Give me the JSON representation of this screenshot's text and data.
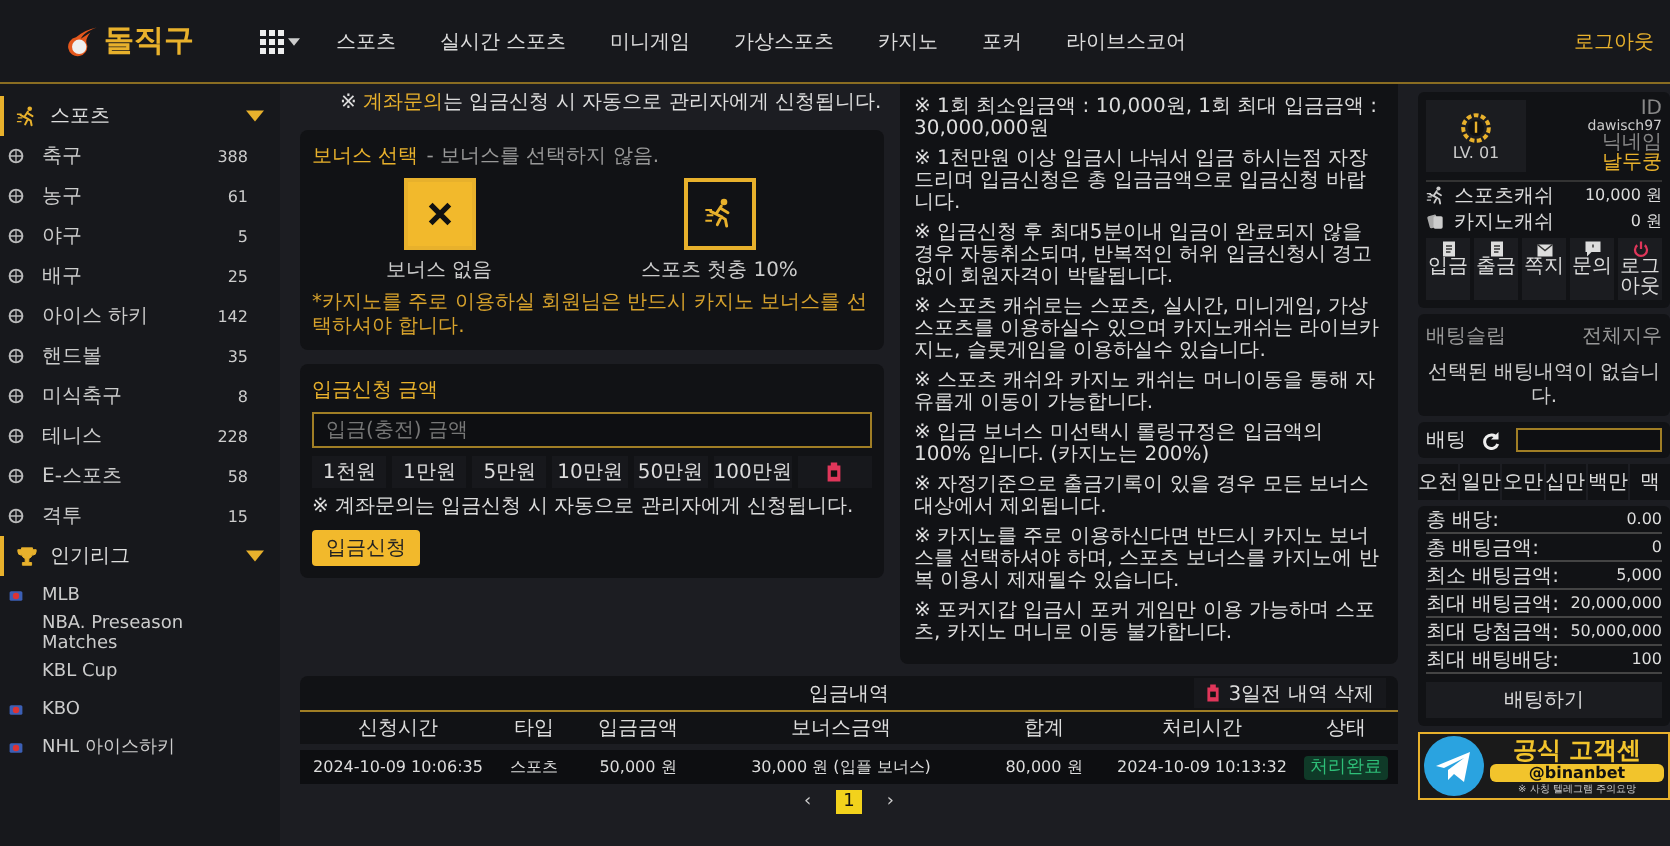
{
  "header": {
    "logo": "돌직구",
    "nav": [
      "스포츠",
      "실시간 스포츠",
      "미니게임",
      "가상스포츠",
      "카지노",
      "포커",
      "라이브스코어"
    ],
    "logout": "로그아웃"
  },
  "sidebar": {
    "sections": [
      {
        "title": "스포츠",
        "kind": "sports",
        "expanded": true,
        "items": [
          {
            "name": "축구",
            "count": "388"
          },
          {
            "name": "농구",
            "count": "61"
          },
          {
            "name": "야구",
            "count": "5"
          },
          {
            "name": "배구",
            "count": "25"
          },
          {
            "name": "아이스 하키",
            "count": "142"
          },
          {
            "name": "핸드볼",
            "count": "35"
          },
          {
            "name": "미식축구",
            "count": "8"
          },
          {
            "name": "테니스",
            "count": "228"
          },
          {
            "name": "E-스포츠",
            "count": "58"
          },
          {
            "name": "격투",
            "count": "15"
          }
        ]
      },
      {
        "title": "인기리그",
        "kind": "trophy",
        "expanded": true,
        "items": [
          {
            "name": "MLB",
            "has_icon": true
          },
          {
            "name": "NBA. Preseason Matches",
            "has_icon": false
          },
          {
            "name": "KBL Cup",
            "has_icon": false
          },
          {
            "name": "KBO",
            "has_icon": true
          },
          {
            "name": "NHL 아이스하키",
            "has_icon": true
          }
        ]
      }
    ]
  },
  "top_note": "※ **계좌문의**는 입금신청 시 자동으로 관리자에게 신청됩니다.",
  "bonus": {
    "title": "보너스 선택",
    "status": "- 보너스를 선택하지 않음.",
    "options": [
      {
        "label": "보너스 없음",
        "kind": "none",
        "selected": true
      },
      {
        "label": "스포츠 첫충 10%",
        "kind": "sports",
        "selected": false
      }
    ],
    "note": "*카지노를 주로 이용하실 회원님은 반드시 카지노 보너스를 선택하셔야 합니다."
  },
  "amount": {
    "title": "입금신청 금액",
    "placeholder": "입금(충전) 금액",
    "quick": [
      "1천원",
      "1만원",
      "5만원",
      "10만원",
      "50만원",
      "100만원"
    ],
    "note": "※ 계좌문의는 입금신청 시 자동으로 관리자에게 신청됩니다.",
    "submit": "입금신청"
  },
  "notices": [
    "※ 1회 최소입금액 : 10,000원, 1회 최대 입금금액 : 30,000,000원",
    "※ 1천만원 이상 입금시 나눠서 입금 하시는점 자장드리며 입금신청은 총 입금금액으로 입금신청 바랍니다.",
    "※ 입금신청 후 최대5분이내 입금이 완료되지 않을 경우 자동취소되며, 반복적인 허위 입금신청시 경고없이 회원자격이 박탈됩니다.",
    "※ 스포츠 캐쉬로는 스포츠, 실시간, 미니게임, 가상스포츠를 이용하실수 있으며 카지노캐쉬는 라이브카지노, 슬롯게임을 이용하실수 있습니다.",
    "※ 스포츠 캐쉬와 카지노 캐쉬는 머니이동을 통해 자유롭게 이동이 가능합니다.",
    "※ 입금 보너스 미선택시 롤링규정은 입금액의 100% 입니다. (카지노는 200%)",
    "※ 자정기준으로 출금기록이 있을 경우 모든 보너스 대상에서 제외됩니다.",
    "※ 카지노를 주로 이용하신다면 반드시 카지노 보너스를 선택하셔야 하며, 스포츠 보너스를 카지노에 반복 이용시 제재될수 있습니다.",
    "※ 포커지갑 입금시 포커 게임만 이용 가능하며 스포츠, 카지노 머니로 이동 불가합니다."
  ],
  "history": {
    "title": "입금내역",
    "delete": "3일전 내역 삭제",
    "columns": [
      "신청시간",
      "타입",
      "입금금액",
      "보너스금액",
      "합계",
      "처리시간",
      "상태"
    ],
    "rows": [
      {
        "cells": [
          "2024-10-09 10:06:35",
          "스포츠",
          "50,000 원",
          "30,000 원 (입플 보너스)",
          "80,000 원",
          "2024-10-09 10:13:32"
        ],
        "status": "처리완료"
      }
    ],
    "pagination": {
      "prev": "‹",
      "pages": [
        {
          "label": "1",
          "selected": true
        }
      ],
      "next": "›"
    }
  },
  "profile": {
    "level": "LV. 01",
    "id_label": "ID",
    "id": "dawisch97",
    "nick_label": "닉네임",
    "nick": "날두쿵",
    "cash": [
      {
        "kind": "sports",
        "label": "스포츠캐쉬",
        "value": "10,000 원"
      },
      {
        "kind": "casino",
        "label": "카지노캐쉬",
        "value": "0 원"
      }
    ],
    "actions": [
      {
        "kind": "deposit",
        "label": "입금"
      },
      {
        "kind": "withdraw",
        "label": "출금"
      },
      {
        "kind": "message",
        "label": "쪽지"
      },
      {
        "kind": "inquiry",
        "label": "문의"
      },
      {
        "kind": "logout",
        "label": "로그아웃"
      }
    ]
  },
  "slip": {
    "title": "배팅슬립",
    "clear": "전체지우",
    "empty": "선택된 배팅내역이 없습니다."
  },
  "bet": {
    "label": "배팅",
    "amounts": [
      "오천",
      "일만",
      "오만",
      "십만",
      "백만",
      "맥"
    ],
    "stats": [
      {
        "label": "총 배당:",
        "value": "0.00"
      },
      {
        "label": "총 배팅금액:",
        "value": "0"
      },
      {
        "label": "최소 배팅금액:",
        "value": "5,000"
      },
      {
        "label": "최대 배팅금액:",
        "value": "20,000,000"
      },
      {
        "label": "최대 당첨금액:",
        "value": "50,000,000"
      },
      {
        "label": "최대 배팅배당:",
        "value": "100"
      }
    ],
    "submit": "배팅하기"
  },
  "banner": {
    "title": "공식 고객센",
    "handle": "@binanbet",
    "note": "※ 사칭 텔레그램 주의요망"
  }
}
